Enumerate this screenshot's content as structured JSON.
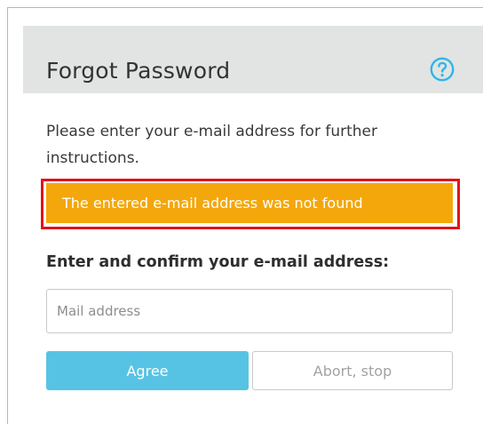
{
  "dialog": {
    "title": "Forgot Password",
    "help_icon": "question-circle-icon",
    "instructions": "Please enter your e-mail address for further instructions.",
    "error_message": "The entered e-mail address was not found",
    "confirm_label": "Enter and confirm your e-mail address:",
    "email_input": {
      "value": "",
      "placeholder": "Mail address"
    },
    "agree_label": "Agree",
    "abort_label": "Abort, stop"
  },
  "colors": {
    "header_background": "#e1e4e3",
    "error_background": "#f4a70b",
    "error_highlight": "#e21219",
    "primary_button": "#57c3e4",
    "help_icon": "#33b4e8"
  }
}
